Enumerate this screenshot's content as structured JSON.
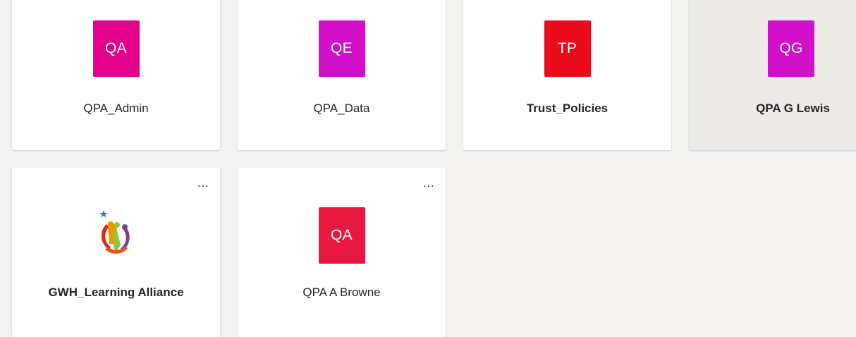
{
  "teams": [
    {
      "initials": "QA",
      "name": "QPA_Admin",
      "color": "#e3008c",
      "bold": false
    },
    {
      "initials": "QE",
      "name": "QPA_Data",
      "color": "#d20fc9",
      "bold": false
    },
    {
      "initials": "TP",
      "name": "Trust_Policies",
      "color": "#ea0b1a",
      "bold": true
    },
    {
      "initials": "QG",
      "name": "QPA G Lewis",
      "color": "#d20fc9",
      "bold": true
    },
    {
      "initials": "",
      "name": "GWH_Learning Alliance",
      "logo": "learning-alliance-logo",
      "bold": true
    },
    {
      "initials": "QA",
      "name": "QPA A Browne",
      "color": "#e8173f",
      "bold": false
    }
  ],
  "more_options_label": "...",
  "top_fragment": "y"
}
